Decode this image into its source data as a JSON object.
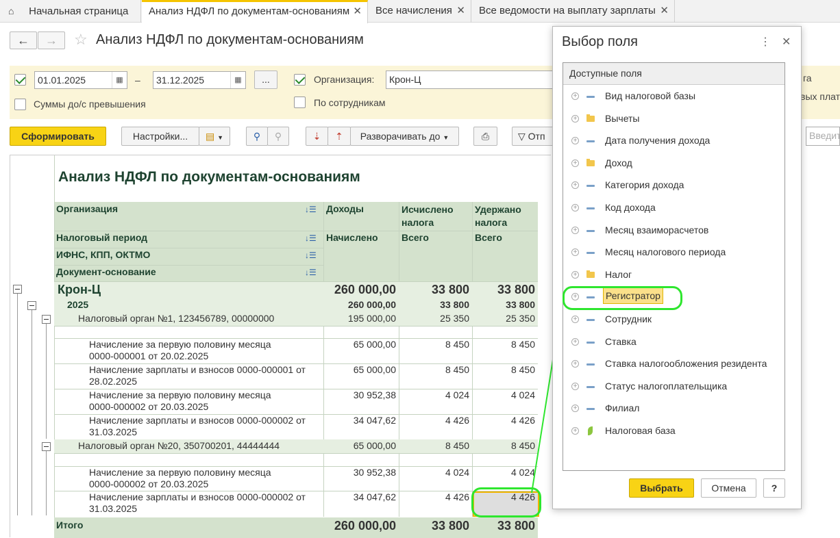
{
  "tabs": [
    {
      "label": "Начальная страница"
    },
    {
      "label": "Анализ НДФЛ по документам-основаниям"
    },
    {
      "label": "Все начисления"
    },
    {
      "label": "Все ведомости на выплату зарплаты"
    }
  ],
  "page": {
    "title": "Анализ НДФЛ по документам-основаниям"
  },
  "filters": {
    "date_from": "01.01.2025",
    "date_sep": "–",
    "date_to": "31.12.2025",
    "dots": "...",
    "org_label": "Организация:",
    "org_value": "Крон-Ц",
    "sums_label": "Суммы до/с превышения",
    "by_employees_label": "По сотрудникам",
    "right_fragment_1": "га",
    "right_fragment_2": "вых плат"
  },
  "toolbar": {
    "generate": "Сформировать",
    "settings": "Настройки...",
    "expand": "Разворачивать до",
    "send_fragment": "Отп",
    "input_placeholder": "Введит"
  },
  "report": {
    "title": "Анализ НДФЛ по документам-основаниям",
    "headers": {
      "organization": "Организация",
      "tax_period": "Налоговый период",
      "ifns": "ИФНС, КПП, ОКТМО",
      "document": "Документ-основание",
      "income": "Доходы",
      "accrued_tax": "Исчислено налога",
      "withheld_tax": "Удержано налога",
      "accrued": "Начислено",
      "total1": "Всего",
      "total2": "Всего"
    },
    "rows": [
      {
        "label": "Крон-Ц",
        "income": "260 000,00",
        "calc": "33 800",
        "held": "33 800"
      },
      {
        "label": "2025",
        "income": "260 000,00",
        "calc": "33 800",
        "held": "33 800"
      },
      {
        "label": "Налоговый орган №1, 123456789, 00000000",
        "income": "195 000,00",
        "calc": "25 350",
        "held": "25 350"
      },
      {
        "label1": "Начисление за первую половину месяца",
        "label2": "0000-000001 от 20.02.2025",
        "income": "65 000,00",
        "calc": "8 450",
        "held": "8 450"
      },
      {
        "label1": "Начисление зарплаты и взносов 0000-000001 от",
        "label2": "28.02.2025",
        "income": "65 000,00",
        "calc": "8 450",
        "held": "8 450"
      },
      {
        "label1": "Начисление за первую половину месяца",
        "label2": "0000-000002 от 20.03.2025",
        "income": "30 952,38",
        "calc": "4 024",
        "held": "4 024"
      },
      {
        "label1": "Начисление зарплаты и взносов 0000-000002 от",
        "label2": "31.03.2025",
        "income": "34 047,62",
        "calc": "4 426",
        "held": "4 426"
      },
      {
        "label": "Налоговый орган №20, 350700201, 44444444",
        "income": "65 000,00",
        "calc": "8 450",
        "held": "8 450"
      },
      {
        "label1": "Начисление за первую половину месяца",
        "label2": "0000-000002 от 20.03.2025",
        "income": "30 952,38",
        "calc": "4 024",
        "held": "4 024"
      },
      {
        "label1": "Начисление зарплаты и взносов 0000-000002 от",
        "label2": "31.03.2025",
        "income": "34 047,62",
        "calc": "4 426",
        "held": "4 426"
      },
      {
        "label": "Итого",
        "income": "260 000,00",
        "calc": "33 800",
        "held": "33 800"
      }
    ]
  },
  "dialog": {
    "title": "Выбор поля",
    "list_header": "Доступные поля",
    "items": [
      {
        "label": "Вид налоговой базы",
        "icon": "field-icon"
      },
      {
        "label": "Вычеты",
        "icon": "folder-icon"
      },
      {
        "label": "Дата получения дохода",
        "icon": "field-icon"
      },
      {
        "label": "Доход",
        "icon": "folder-icon"
      },
      {
        "label": "Категория дохода",
        "icon": "field-icon"
      },
      {
        "label": "Код дохода",
        "icon": "field-icon"
      },
      {
        "label": "Месяц взаиморасчетов",
        "icon": "field-icon"
      },
      {
        "label": "Месяц налогового периода",
        "icon": "field-icon"
      },
      {
        "label": "Налог",
        "icon": "folder-icon"
      },
      {
        "label": "Регистратор",
        "icon": "field-icon"
      },
      {
        "label": "Сотрудник",
        "icon": "field-icon"
      },
      {
        "label": "Ставка",
        "icon": "field-icon"
      },
      {
        "label": "Ставка налогообложения резидента",
        "icon": "field-icon"
      },
      {
        "label": "Статус налогоплательщика",
        "icon": "field-icon"
      },
      {
        "label": "Филиал",
        "icon": "field-icon"
      },
      {
        "label": "Налоговая база",
        "icon": "resource-icon"
      }
    ],
    "select_button": "Выбрать",
    "cancel_button": "Отмена",
    "help_button": "?"
  },
  "colors": {
    "accent": "#f8d315",
    "highlight_ring": "#2ee62e",
    "header_bg": "#d4e2cd"
  }
}
